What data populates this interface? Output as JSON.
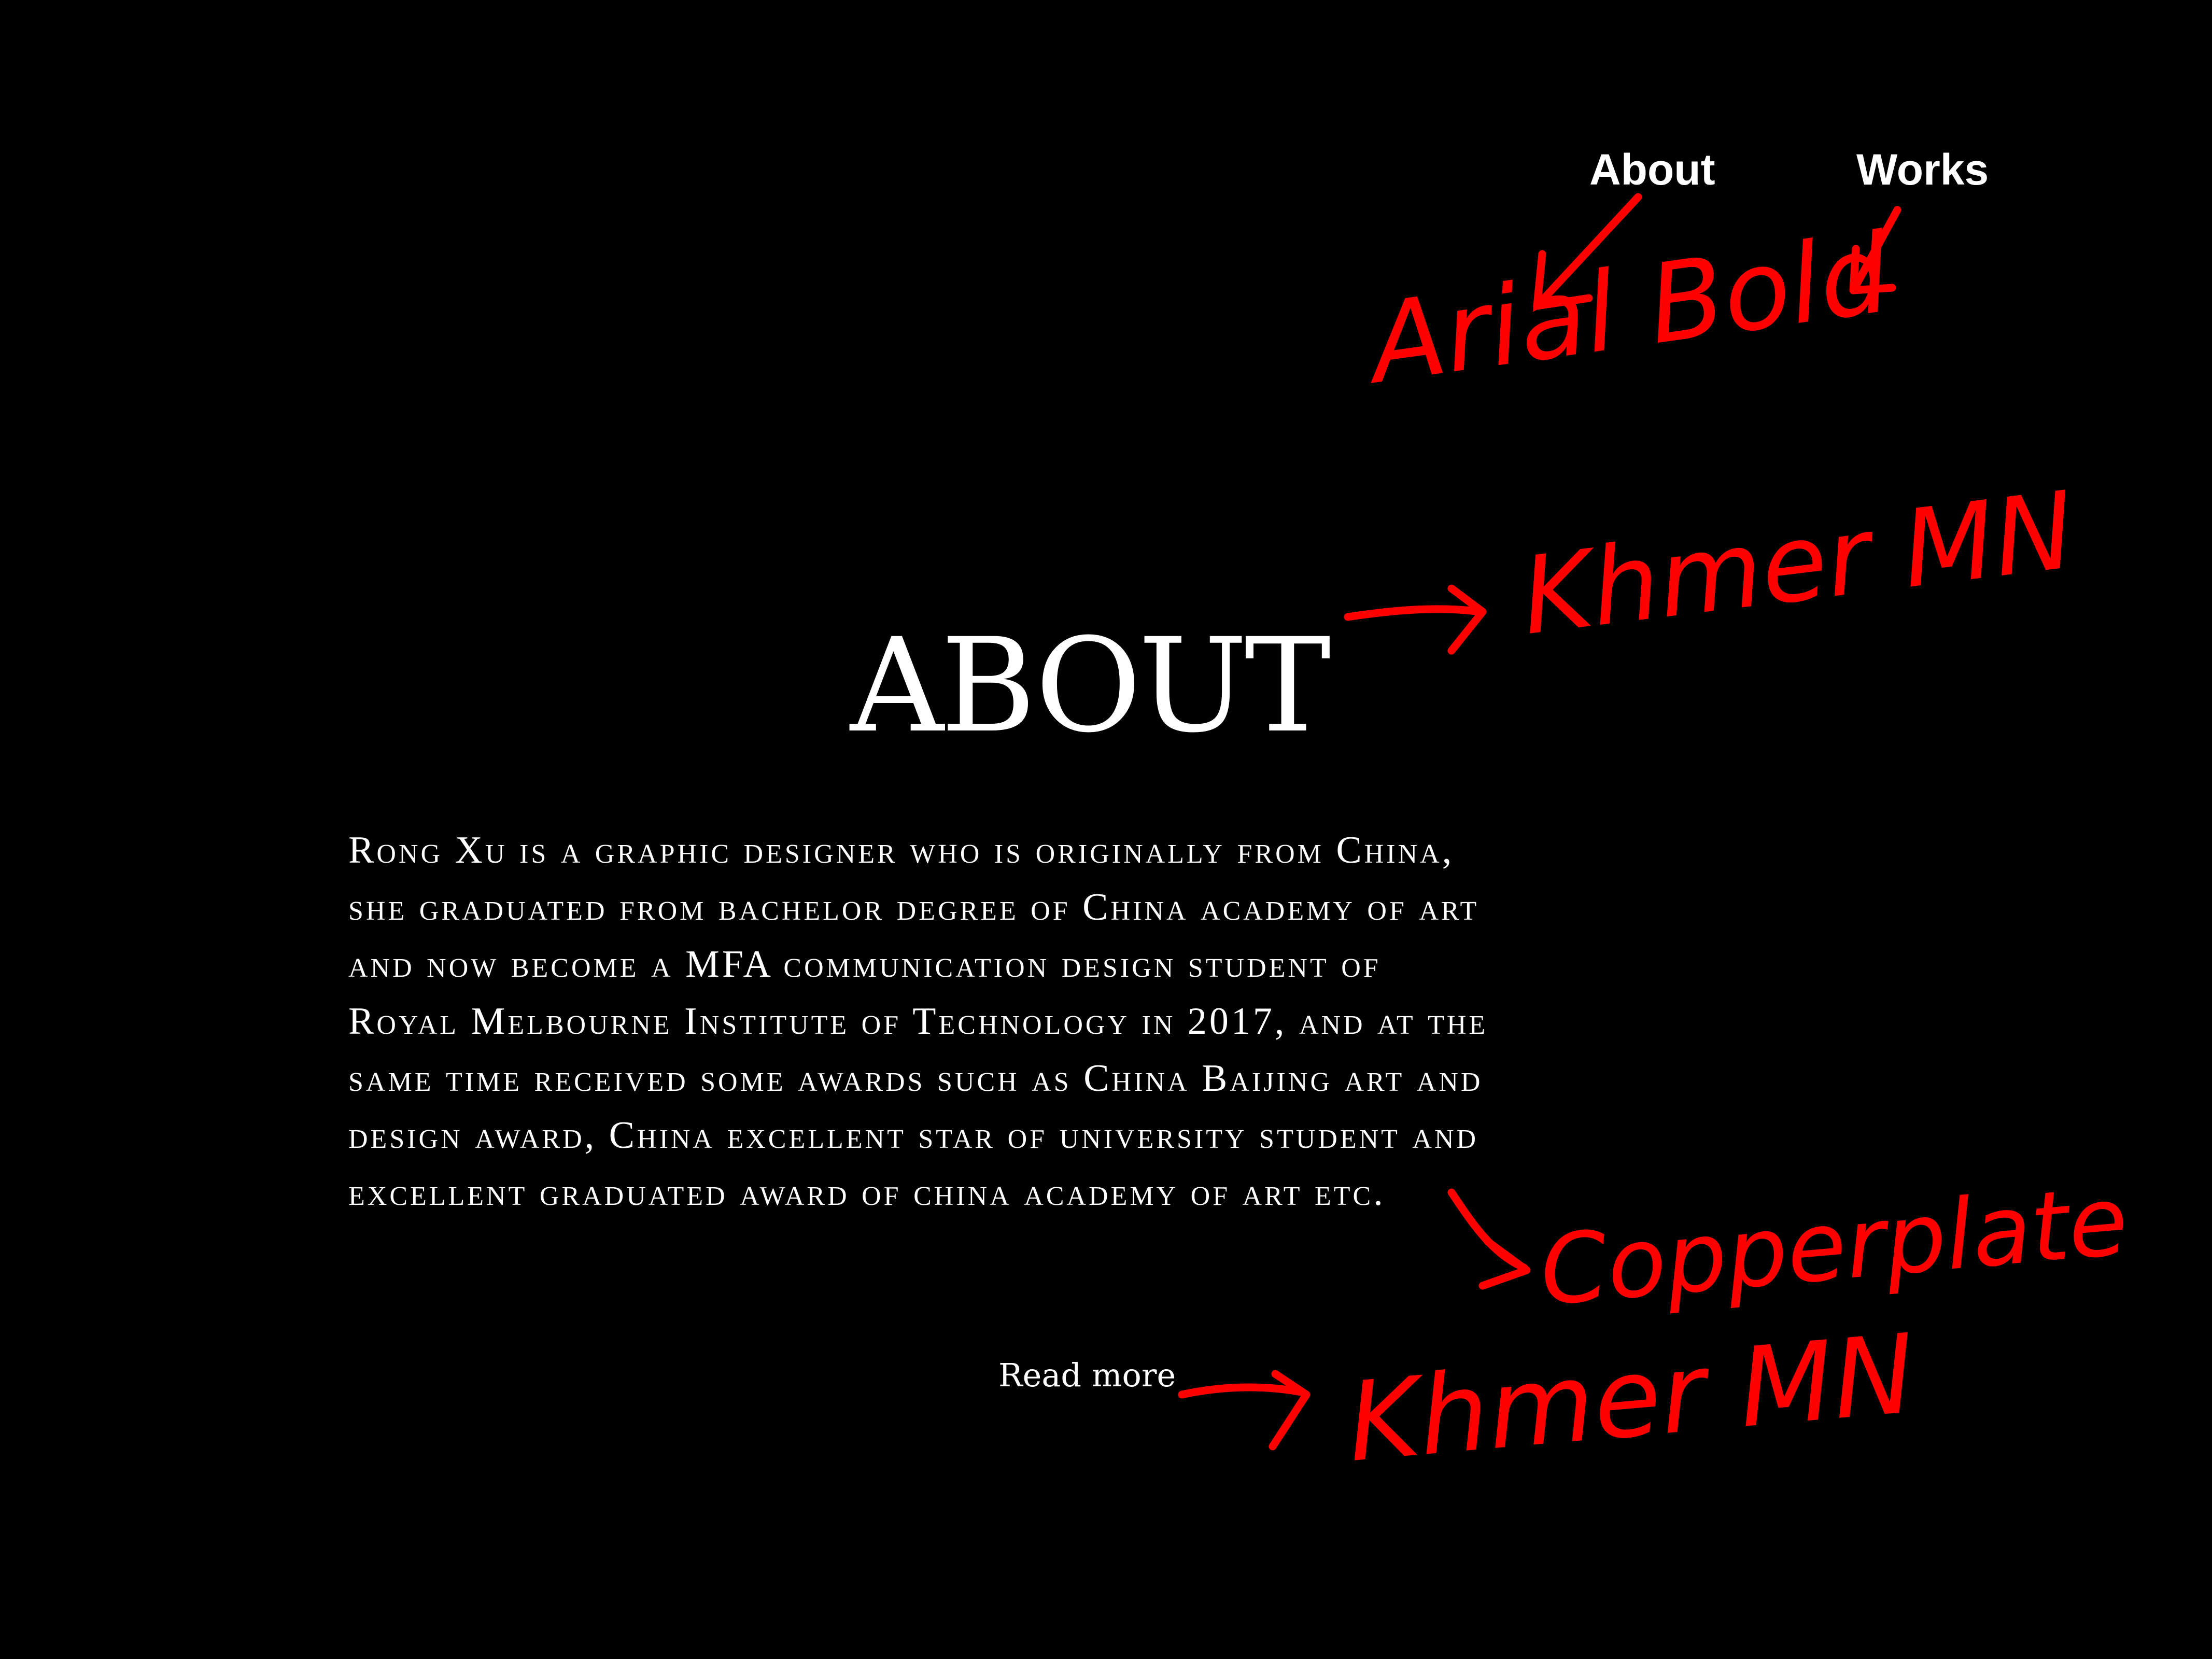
{
  "nav": {
    "about": "About",
    "works": "Works"
  },
  "heading": "ABOUT",
  "bio": {
    "lines": [
      "Rong Xu is a graphic designer who is originally from China,",
      "she graduated from bachelor degree of China academy of art",
      "and now become a MFA communication design student of",
      "Royal Melbourne Institute of Technology in 2017, and at the",
      "same time received some awards such as China Baijing art and",
      "design award, China excellent star of university student and",
      "excellent graduated award of china academy of art etc."
    ]
  },
  "read_more": "Read more",
  "annotations": {
    "nav_font": "Arial Bold",
    "heading_font": "Khmer MN",
    "bio_font": "Copperplate",
    "read_more_font": "Khmer MN",
    "color": "#ff0000"
  },
  "colors": {
    "background": "#000000",
    "text": "#ffffff"
  }
}
